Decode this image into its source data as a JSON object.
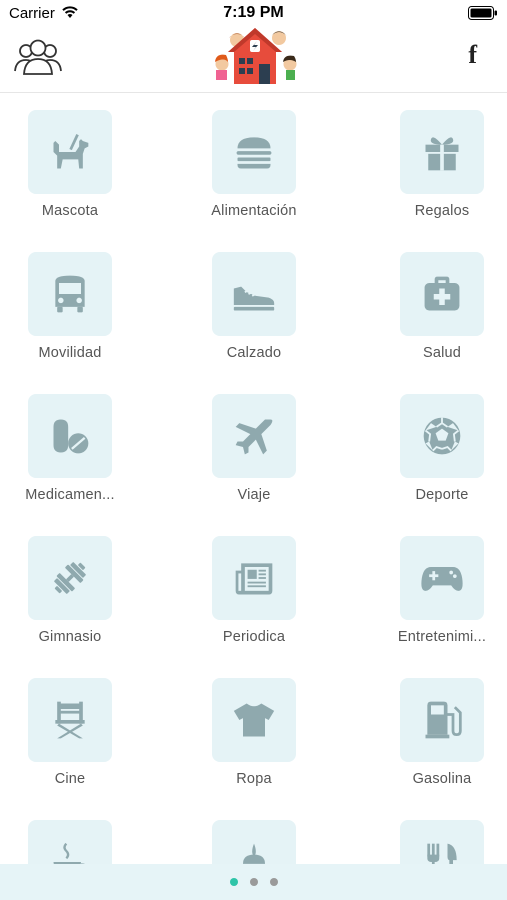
{
  "status_bar": {
    "carrier": "Carrier",
    "time": "7:19 PM"
  },
  "nav": {
    "facebook_label": "f"
  },
  "categories": [
    {
      "label": "Mascota",
      "icon": "dog-icon"
    },
    {
      "label": "Alimentación",
      "icon": "burger-icon"
    },
    {
      "label": "Regalos",
      "icon": "gift-icon"
    },
    {
      "label": "Movilidad",
      "icon": "bus-icon"
    },
    {
      "label": "Calzado",
      "icon": "shoe-icon"
    },
    {
      "label": "Salud",
      "icon": "first-aid-icon"
    },
    {
      "label": "Medicamen...",
      "icon": "pills-icon"
    },
    {
      "label": "Viaje",
      "icon": "plane-icon"
    },
    {
      "label": "Deporte",
      "icon": "soccer-ball-icon"
    },
    {
      "label": "Gimnasio",
      "icon": "dumbbell-icon"
    },
    {
      "label": "Periodica",
      "icon": "newspaper-icon"
    },
    {
      "label": "Entretenimi...",
      "icon": "gamepad-icon"
    },
    {
      "label": "Cine",
      "icon": "director-chair-icon"
    },
    {
      "label": "Ropa",
      "icon": "tshirt-icon"
    },
    {
      "label": "Gasolina",
      "icon": "gas-pump-icon"
    },
    {
      "label": "",
      "icon": "coffee-icon"
    },
    {
      "label": "",
      "icon": "ice-cream-icon"
    },
    {
      "label": "",
      "icon": "restaurant-icon"
    }
  ],
  "pager": {
    "pages": 3,
    "current": 1
  },
  "colors": {
    "tile_bg": "#e5f3f6",
    "icon": "#8fa9ae",
    "pager_bg": "#e6f4f7",
    "active_dot": "#2ec4a8",
    "inactive_dot": "#9a9a9a"
  }
}
